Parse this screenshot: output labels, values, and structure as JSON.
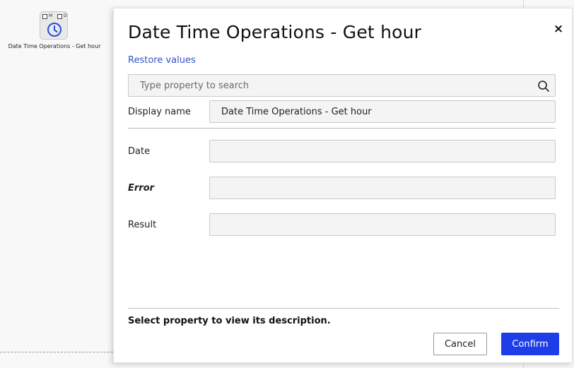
{
  "canvas": {
    "node": {
      "flag_m": "M",
      "flag_d": "D",
      "icon": "clock-icon",
      "label": "Date Time Operations - Get hour"
    }
  },
  "dialog": {
    "title": "Date Time Operations - Get hour",
    "close_label": "×",
    "restore_label": "Restore values",
    "search": {
      "placeholder": "Type property to search",
      "value": "",
      "icon": "search-icon"
    },
    "display_name": {
      "label": "Display name",
      "value": "Date Time Operations - Get hour"
    },
    "properties": [
      {
        "label": "Date",
        "value": ""
      },
      {
        "label": "Error",
        "value": "",
        "emphasis": "bold-italic"
      },
      {
        "label": "Result",
        "value": ""
      }
    ],
    "description": "Select property to view its description.",
    "buttons": {
      "cancel": "Cancel",
      "confirm": "Confirm"
    }
  },
  "colors": {
    "accent": "#1d3de8",
    "link": "#2e52c6",
    "clock_icon": "#2a4fd0"
  }
}
